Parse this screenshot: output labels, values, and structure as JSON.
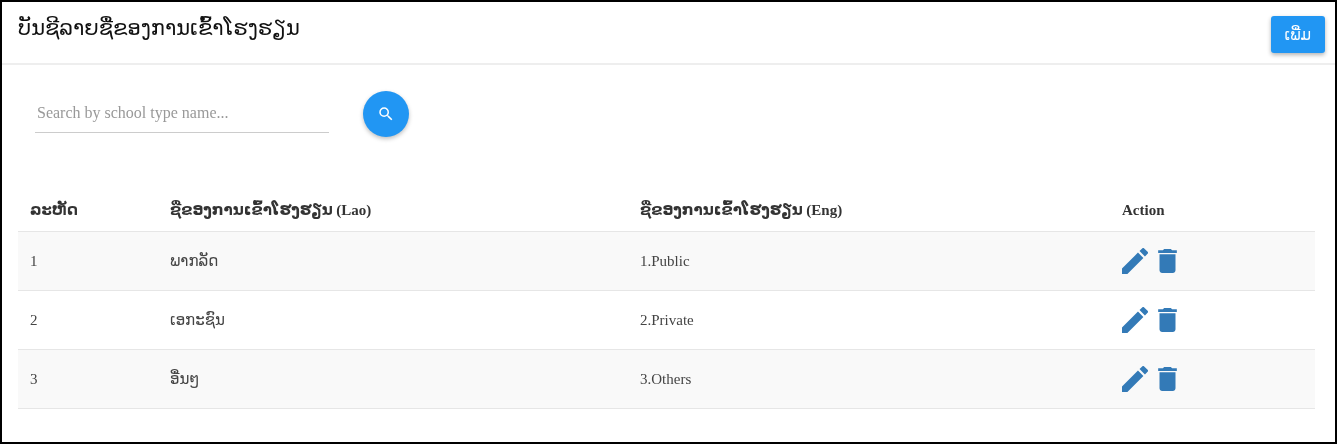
{
  "title": "ບັນຊີລາຍຊື່ຂອງການເຂົ້າໂຮງຮຽນ",
  "add_button": "ເພີ່ມ",
  "search": {
    "placeholder": "Search by school type name..."
  },
  "table": {
    "columns": [
      "ລະຫັດ",
      "ຊື່ຂອງການເຂົ້າໂຮງຮຽນ (Lao)",
      "ຊື່ຂອງການເຂົ້າໂຮງຮຽນ (Eng)",
      "Action"
    ],
    "rows": [
      {
        "id": "1",
        "name_lao": "ພາກລັດ",
        "name_eng": "1.Public"
      },
      {
        "id": "2",
        "name_lao": "ເອກະຊົນ",
        "name_eng": "2.Private"
      },
      {
        "id": "3",
        "name_lao": "ອື່ນໆ",
        "name_eng": "3.Others"
      }
    ]
  }
}
